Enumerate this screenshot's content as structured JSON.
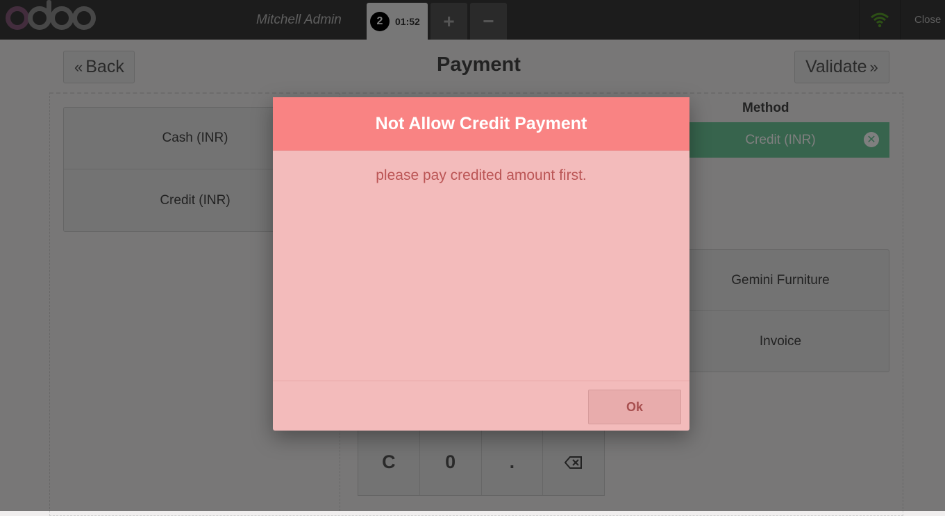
{
  "header": {
    "username": "Mitchell Admin",
    "order_number": "2",
    "order_time": "01:52",
    "add_order_label": "+",
    "remove_order_label": "−",
    "close_label": "Close",
    "wifi_color": "#5aa02c"
  },
  "payment_screen": {
    "back_label": "Back",
    "title": "Payment",
    "validate_label": "Validate",
    "methods": [
      "Cash (INR)",
      "Credit (INR)"
    ],
    "method_header": "Method",
    "paymentline": "Credit (INR)",
    "right_buttons": [
      "Gemini Furniture",
      "Invoice"
    ],
    "numpad": [
      "C",
      "0",
      "."
    ]
  },
  "dialog": {
    "title": "Not Allow Credit Payment",
    "message": "please pay credited amount first.",
    "ok_label": "Ok",
    "title_color": "#f98383",
    "body_color": "#f3bbbb"
  }
}
